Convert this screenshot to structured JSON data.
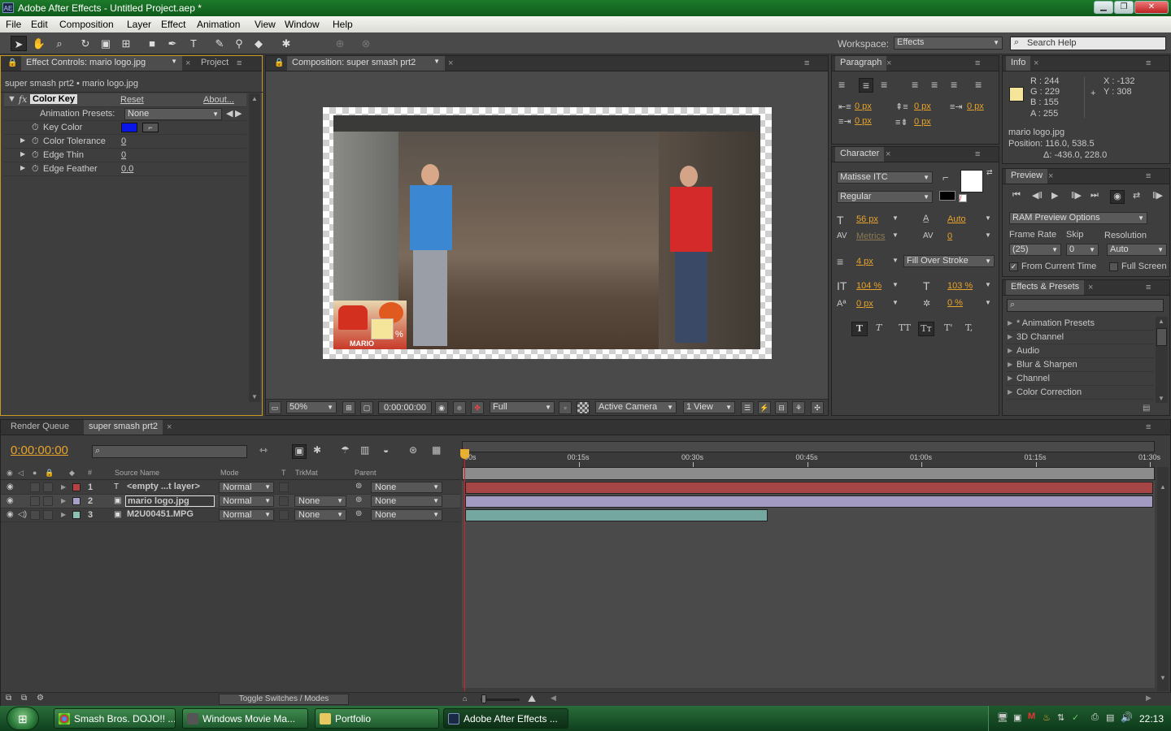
{
  "window": {
    "title": "Adobe After Effects - Untitled Project.aep *",
    "app_icon": "AE"
  },
  "menu": [
    "File",
    "Edit",
    "Composition",
    "Layer",
    "Effect",
    "Animation",
    "View",
    "Window",
    "Help"
  ],
  "workspace": {
    "label": "Workspace:",
    "value": "Effects",
    "search_placeholder": "Search Help"
  },
  "effect_controls": {
    "tab": "Effect Controls: mario logo.jpg",
    "tab2": "Project",
    "path": "super smash prt2 • mario logo.jpg",
    "effect_name": "Color Key",
    "reset": "Reset",
    "about": "About...",
    "presets_label": "Animation Presets:",
    "presets_value": "None",
    "params": [
      {
        "label": "Key Color",
        "value": ""
      },
      {
        "label": "Color Tolerance",
        "value": "0"
      },
      {
        "label": "Edge Thin",
        "value": "0"
      },
      {
        "label": "Edge Feather",
        "value": "0.0"
      }
    ],
    "key_color": "#0a16e8"
  },
  "composition": {
    "tab": "Composition: super smash prt2",
    "zoom": "50%",
    "timecode": "0:00:00:00",
    "resolution": "Full",
    "camera": "Active Camera",
    "views": "1 View",
    "overlay_text": "MARIO"
  },
  "paragraph": {
    "tab": "Paragraph",
    "values": [
      "0 px",
      "0 px",
      "0 px",
      "0 px",
      "0 px"
    ]
  },
  "character": {
    "tab": "Character",
    "font": "Matisse ITC",
    "style": "Regular",
    "size": "56 px",
    "leading": "Auto",
    "kerning": "Metrics",
    "tracking": "0",
    "stroke_width": "4 px",
    "stroke_mode": "Fill Over Stroke",
    "vscale": "104 %",
    "hscale": "103 %",
    "baseline": "0 px",
    "tsume": "0 %",
    "style_buttons": [
      "T",
      "T",
      "TT",
      "Tт",
      "T'",
      "T,"
    ]
  },
  "info": {
    "tab": "Info",
    "r": "R : 244",
    "g": "G : 229",
    "b": "B : 155",
    "a": "A : 255",
    "x": "X : -132",
    "y": "Y : 308",
    "swatch": "#f4e59b",
    "layer": "mario logo.jpg",
    "position": "Position: 116.0, 538.5",
    "delta": "Δ: -436.0, 228.0"
  },
  "preview": {
    "tab": "Preview",
    "ram_options": "RAM Preview Options",
    "frame_rate_label": "Frame Rate",
    "skip_label": "Skip",
    "resolution_label": "Resolution",
    "frame_rate": "(25)",
    "skip": "0",
    "resolution": "Auto",
    "from_current": "From Current Time",
    "full_screen": "Full Screen"
  },
  "effects_presets": {
    "tab": "Effects & Presets",
    "items": [
      "* Animation Presets",
      "3D Channel",
      "Audio",
      "Blur & Sharpen",
      "Channel",
      "Color Correction"
    ]
  },
  "timeline": {
    "tab1": "Render Queue",
    "tab2": "super smash prt2",
    "timecode": "0:00:00:00",
    "headers": {
      "num": "#",
      "source": "Source Name",
      "mode": "Mode",
      "t": "T",
      "trkmat": "TrkMat",
      "parent": "Parent"
    },
    "ruler": [
      "00s",
      "00:15s",
      "00:30s",
      "00:45s",
      "01:00s",
      "01:15s",
      "01:30s"
    ],
    "layers": [
      {
        "num": "1",
        "name": "<empty ...t layer>",
        "mode": "Normal",
        "trkmat": "",
        "parent": "None",
        "color": "#b44444",
        "bar": "#a54545",
        "end": 1.0
      },
      {
        "num": "2",
        "name": "mario logo.jpg",
        "mode": "Normal",
        "trkmat": "None",
        "parent": "None",
        "color": "#a8a0c8",
        "bar": "#a29ac0",
        "end": 1.0
      },
      {
        "num": "3",
        "name": "M2U00451.MPG",
        "mode": "Normal",
        "trkmat": "None",
        "parent": "None",
        "color": "#8ec0b8",
        "bar": "#73a79f",
        "end": 0.44
      }
    ],
    "toggle_label": "Toggle Switches / Modes"
  },
  "taskbar": {
    "items": [
      "Smash Bros. DOJO!! ...",
      "Windows Movie Ma...",
      "Portfolio",
      "Adobe After Effects ..."
    ],
    "clock": "22:13"
  }
}
